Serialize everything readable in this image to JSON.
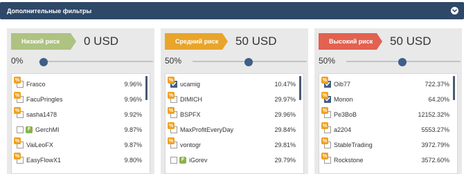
{
  "header": {
    "title": "Дополнительные фильтры"
  },
  "badge_glyphs": {
    "percent": "%",
    "f": "F"
  },
  "columns": [
    {
      "risk_label": "Низкий риск",
      "risk_color": "#aec281",
      "amount": "0 USD",
      "percent_label": "0%",
      "slider_value": 0,
      "rows": [
        {
          "name": "Frasco",
          "value": "9.96%",
          "checked": false,
          "icon": "percent"
        },
        {
          "name": "FacuPringles",
          "value": "9.96%",
          "checked": false,
          "icon": "percent"
        },
        {
          "name": "sasha1478",
          "value": "9.92%",
          "checked": false,
          "icon": "percent"
        },
        {
          "name": "GerchMI",
          "value": "9.87%",
          "checked": false,
          "icon": "f"
        },
        {
          "name": "VaiLeoFX",
          "value": "9.87%",
          "checked": false,
          "icon": "percent"
        },
        {
          "name": "EasyFlowX1",
          "value": "9.80%",
          "checked": false,
          "icon": "percent"
        }
      ]
    },
    {
      "risk_label": "Средний риск",
      "risk_color": "#e9a52a",
      "amount": "50 USD",
      "percent_label": "50%",
      "slider_value": 50,
      "rows": [
        {
          "name": "ucamig",
          "value": "10.47%",
          "checked": true,
          "icon": "percent"
        },
        {
          "name": "DIMICH",
          "value": "29.97%",
          "checked": false,
          "icon": "percent"
        },
        {
          "name": "BSPFX",
          "value": "29.96%",
          "checked": false,
          "icon": "percent"
        },
        {
          "name": "MaxProfitEveryDay",
          "value": "29.84%",
          "checked": false,
          "icon": "percent"
        },
        {
          "name": "vontogr",
          "value": "29.81%",
          "checked": false,
          "icon": "percent"
        },
        {
          "name": "iGorev",
          "value": "29.79%",
          "checked": false,
          "icon": "f"
        }
      ]
    },
    {
      "risk_label": "Высокий риск",
      "risk_color": "#e26150",
      "amount": "50 USD",
      "percent_label": "50%",
      "slider_value": 50,
      "rows": [
        {
          "name": "Oib77",
          "value": "722.37%",
          "checked": true,
          "icon": "percent"
        },
        {
          "name": "Monon",
          "value": "64.20%",
          "checked": true,
          "icon": "percent"
        },
        {
          "name": "Pe3BoB",
          "value": "12152.32%",
          "checked": false,
          "icon": "percent"
        },
        {
          "name": "a2204",
          "value": "5553.27%",
          "checked": false,
          "icon": "percent"
        },
        {
          "name": "StableTrading",
          "value": "3972.79%",
          "checked": false,
          "icon": "percent"
        },
        {
          "name": "Rockstone",
          "value": "3572.60%",
          "checked": false,
          "icon": "percent"
        }
      ]
    }
  ]
}
